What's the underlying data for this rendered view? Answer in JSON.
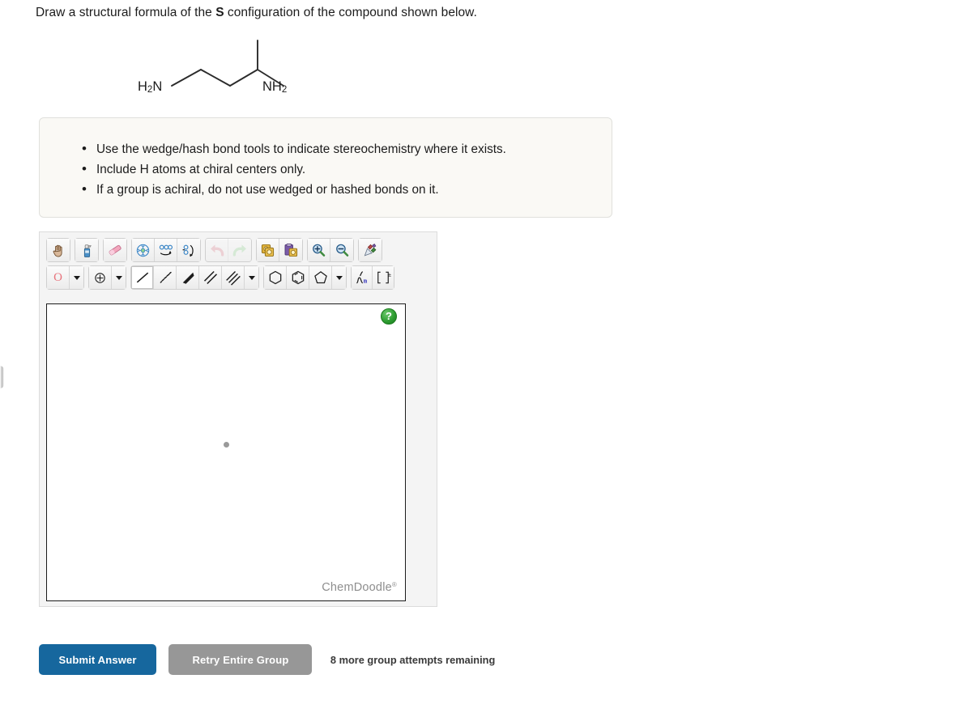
{
  "prompt": {
    "before": "Draw a structural formula of the ",
    "emphasis": "S",
    "after": " configuration of the compound shown below."
  },
  "structure": {
    "name": "butane-1,3-diamine-skeletal-structure",
    "left_label_main": "H",
    "left_label_sub": "2",
    "left_label_tail": "N",
    "right_label_main": "NH",
    "right_label_sub": "2"
  },
  "instructions": {
    "items": [
      "Use the wedge/hash bond tools to indicate stereochemistry where it exists.",
      "Include H atoms at chiral centers only.",
      "If a group is achiral, do not use wedged or hashed bonds on it."
    ]
  },
  "sketcher": {
    "brand": "ChemDoodle",
    "brand_mark": "®",
    "help_label": "?",
    "element_selector": "O",
    "toolbar_row1": [
      {
        "name": "pan-hand-tool",
        "title": "Move / Pan"
      },
      {
        "name": "clear-spray-tool",
        "title": "Clear"
      },
      {
        "name": "eraser-tool",
        "title": "Erase"
      },
      {
        "name": "optimize-structure-tool",
        "title": "Clean / Optimize"
      },
      {
        "name": "flip-horizontal-tool",
        "title": "Flip Horizontal"
      },
      {
        "name": "flip-vertical-tool",
        "title": "Flip Vertical"
      },
      {
        "name": "undo-tool",
        "title": "Undo"
      },
      {
        "name": "redo-tool",
        "title": "Redo"
      },
      {
        "name": "copy-tool",
        "title": "Copy"
      },
      {
        "name": "paste-tool",
        "title": "Paste"
      },
      {
        "name": "zoom-in-tool",
        "title": "Zoom In"
      },
      {
        "name": "zoom-out-tool",
        "title": "Zoom Out"
      },
      {
        "name": "template-palette-tool",
        "title": "Templates"
      }
    ],
    "toolbar_row2": [
      {
        "name": "element-selector",
        "title": "Element"
      },
      {
        "name": "element-dropdown",
        "title": "More elements"
      },
      {
        "name": "charge-tool",
        "title": "Charge"
      },
      {
        "name": "charge-dropdown",
        "title": "More charges"
      },
      {
        "name": "single-bond-tool",
        "title": "Single Bond"
      },
      {
        "name": "hash-bond-tool",
        "title": "Hashed Bond"
      },
      {
        "name": "wedge-bond-tool",
        "title": "Wedged Bond"
      },
      {
        "name": "double-bond-tool",
        "title": "Double Bond"
      },
      {
        "name": "triple-bond-tool",
        "title": "Triple Bond"
      },
      {
        "name": "bond-dropdown",
        "title": "More bonds"
      },
      {
        "name": "cyclohexane-ring-tool",
        "title": "Cyclohexane"
      },
      {
        "name": "benzene-ring-tool",
        "title": "Benzene"
      },
      {
        "name": "cyclopentane-ring-tool",
        "title": "Cyclopentane"
      },
      {
        "name": "ring-dropdown",
        "title": "More rings"
      },
      {
        "name": "polymer-repeat-tool",
        "title": "Repeat Unit"
      },
      {
        "name": "bracket-charge-tool",
        "title": "Brackets"
      }
    ]
  },
  "actions": {
    "submit_label": "Submit Answer",
    "retry_label": "Retry Entire Group",
    "attempts_text": "8 more group attempts remaining"
  },
  "colors": {
    "submit_blue": "#16679e",
    "retry_grey": "#979797",
    "help_green": "#2f9e32",
    "element_red": "#e8737c",
    "instruction_bg": "#faf9f5"
  }
}
